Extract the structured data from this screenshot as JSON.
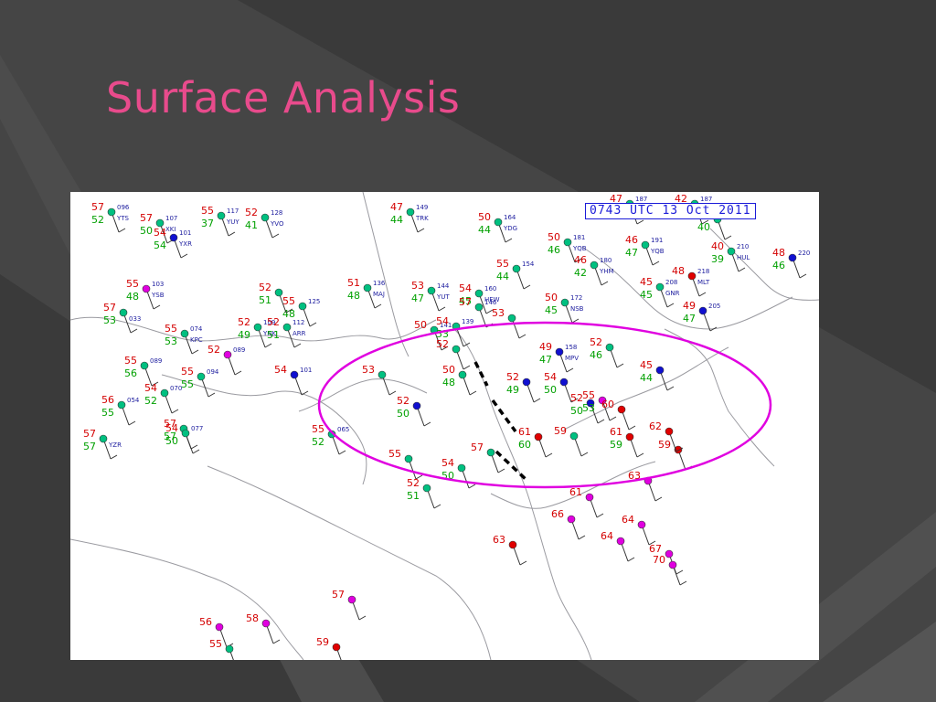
{
  "slide": {
    "title": "Surface Analysis",
    "title_color": "#e84b8c",
    "background_color": "#3a3a3a"
  },
  "map": {
    "timestamp": "0743 UTC 13 Oct 2011",
    "annotation_ellipse_color": "#e000e0",
    "front_color": "#000000",
    "temp_color": "#d40000",
    "dewpoint_color": "#00a000",
    "station_label_color": "#2020a0",
    "cover_colors": {
      "clear": "#00c080",
      "mostly": "#1010d0",
      "rain": "#e000e0",
      "overcast": "#e00000"
    },
    "stations": [
      {
        "t": "57",
        "d": "52",
        "code": "YTS",
        "p": "096",
        "cover": "clear"
      },
      {
        "t": "55",
        "d": "37",
        "code": "YUY",
        "p": "117",
        "cover": "clear"
      },
      {
        "t": "52",
        "d": "41",
        "code": "YVO",
        "p": "128",
        "cover": "clear"
      },
      {
        "t": "57",
        "d": "50",
        "code": "XKI",
        "p": "107",
        "cover": "clear"
      },
      {
        "t": "54",
        "d": "54",
        "code": "YXR",
        "p": "101",
        "cover": "mostly"
      },
      {
        "t": "47",
        "d": "44",
        "code": "TRK",
        "p": "149",
        "cover": "clear"
      },
      {
        "t": "50",
        "d": "44",
        "code": "YDG",
        "p": "164",
        "cover": "clear"
      },
      {
        "t": "50",
        "d": "46",
        "code": "YQB",
        "p": "181",
        "cover": "clear"
      },
      {
        "t": "47",
        "d": "46",
        "code": "YNH",
        "p": "187",
        "cover": "clear"
      },
      {
        "t": "42",
        "d": "40",
        "code": "",
        "p": "187",
        "cover": "clear"
      },
      {
        "t": "44",
        "d": "40",
        "code": "",
        "p": "204",
        "cover": "clear"
      },
      {
        "t": "46",
        "d": "47",
        "code": "YQB",
        "p": "191",
        "cover": "clear"
      },
      {
        "t": "46",
        "d": "42",
        "code": "YHM",
        "p": "180",
        "cover": "clear"
      },
      {
        "t": "40",
        "d": "39",
        "code": "HUL",
        "p": "210",
        "cover": "clear"
      },
      {
        "t": "48",
        "d": "46",
        "code": "",
        "p": "220",
        "cover": "mostly"
      },
      {
        "t": "55",
        "d": "44",
        "code": "",
        "p": "154",
        "cover": "clear"
      },
      {
        "t": "48",
        "d": "",
        "code": "MLT",
        "p": "218",
        "cover": "overcast"
      },
      {
        "t": "45",
        "d": "45",
        "code": "GNR",
        "p": "208",
        "cover": "clear"
      },
      {
        "t": "55",
        "d": "48",
        "code": "YSB",
        "p": "103",
        "cover": "rain"
      },
      {
        "t": "51",
        "d": "48",
        "code": "MAJ",
        "p": "136",
        "cover": "clear"
      },
      {
        "t": "53",
        "d": "47",
        "code": "YUT",
        "p": "144",
        "cover": "clear"
      },
      {
        "t": "54",
        "d": "45",
        "code": "HEW",
        "p": "160",
        "cover": "clear"
      },
      {
        "t": "50",
        "d": "45",
        "code": "NSB",
        "p": "172",
        "cover": "clear"
      },
      {
        "t": "49",
        "d": "47",
        "code": "",
        "p": "205",
        "cover": "mostly"
      },
      {
        "t": "55",
        "d": "48",
        "code": "",
        "p": "125",
        "cover": "clear"
      },
      {
        "t": "52",
        "d": "51",
        "code": "",
        "p": "",
        "cover": "clear"
      },
      {
        "t": "57",
        "d": "",
        "code": "",
        "p": "146",
        "cover": "clear"
      },
      {
        "t": "50",
        "d": "",
        "code": "",
        "p": "141",
        "cover": "clear"
      },
      {
        "t": "57",
        "d": "53",
        "code": "033",
        "p": "",
        "cover": "clear"
      },
      {
        "t": "55",
        "d": "53",
        "code": "KPC",
        "p": "074",
        "cover": "clear"
      },
      {
        "t": "52",
        "d": "49",
        "code": "YNK",
        "p": "109",
        "cover": "clear"
      },
      {
        "t": "52",
        "d": "51",
        "code": "ARR",
        "p": "112",
        "cover": "clear"
      },
      {
        "t": "54",
        "d": "53",
        "code": "",
        "p": "139",
        "cover": "clear"
      },
      {
        "t": "53",
        "d": "",
        "code": "",
        "p": "",
        "cover": "clear"
      },
      {
        "t": "52",
        "d": "",
        "code": "",
        "p": "089",
        "cover": "rain"
      },
      {
        "t": "55",
        "d": "56",
        "code": "",
        "p": "089",
        "cover": "clear"
      },
      {
        "t": "55",
        "d": "55",
        "code": "",
        "p": "094",
        "cover": "clear"
      },
      {
        "t": "54",
        "d": "",
        "code": "",
        "p": "101",
        "cover": "mostly"
      },
      {
        "t": "53",
        "d": "",
        "code": "",
        "p": "",
        "cover": "clear"
      },
      {
        "t": "52",
        "d": "50",
        "code": "",
        "p": "",
        "cover": "mostly"
      },
      {
        "t": "50",
        "d": "48",
        "code": "",
        "p": "",
        "cover": "clear"
      },
      {
        "t": "52",
        "d": "",
        "code": "",
        "p": "",
        "cover": "clear"
      },
      {
        "t": "56",
        "d": "55",
        "code": "",
        "p": "054",
        "cover": "clear"
      },
      {
        "t": "54",
        "d": "52",
        "code": "",
        "p": "070",
        "cover": "clear"
      },
      {
        "t": "57",
        "d": "57",
        "code": "",
        "p": "",
        "cover": "clear"
      },
      {
        "t": "57",
        "d": "57",
        "code": "YZR",
        "p": "",
        "cover": "clear"
      },
      {
        "t": "54",
        "d": "50",
        "code": "",
        "p": "077",
        "cover": "clear"
      },
      {
        "t": "55",
        "d": "52",
        "code": "",
        "p": "065",
        "cover": "clear"
      },
      {
        "t": "61",
        "d": "60",
        "code": "",
        "p": "",
        "cover": "overcast"
      },
      {
        "t": "59",
        "d": "",
        "code": "",
        "p": "",
        "cover": "clear"
      },
      {
        "t": "57",
        "d": "",
        "code": "",
        "p": "",
        "cover": "clear"
      },
      {
        "t": "55",
        "d": "",
        "code": "",
        "p": "",
        "cover": "clear"
      },
      {
        "t": "54",
        "d": "50",
        "code": "",
        "p": "",
        "cover": "clear"
      },
      {
        "t": "52",
        "d": "51",
        "code": "",
        "p": "",
        "cover": "clear"
      },
      {
        "t": "49",
        "d": "47",
        "code": "MPV",
        "p": "158",
        "cover": "mostly"
      },
      {
        "t": "52",
        "d": "46",
        "code": "",
        "p": "",
        "cover": "clear"
      },
      {
        "t": "52",
        "d": "49",
        "code": "",
        "p": "",
        "cover": "mostly"
      },
      {
        "t": "54",
        "d": "50",
        "code": "",
        "p": "",
        "cover": "mostly"
      },
      {
        "t": "45",
        "d": "44",
        "code": "",
        "p": "",
        "cover": "mostly"
      },
      {
        "t": "52",
        "d": "50",
        "code": "",
        "p": "",
        "cover": "mostly"
      },
      {
        "t": "55",
        "d": "53",
        "code": "",
        "p": "",
        "cover": "rain"
      },
      {
        "t": "60",
        "d": "",
        "code": "",
        "p": "",
        "cover": "overcast"
      },
      {
        "t": "59",
        "d": "",
        "code": "",
        "p": "",
        "cover": "overcast"
      },
      {
        "t": "61",
        "d": "59",
        "code": "",
        "p": "",
        "cover": "overcast"
      },
      {
        "t": "62",
        "d": "",
        "code": "",
        "p": "",
        "cover": "overcast"
      },
      {
        "t": "63",
        "d": "",
        "code": "",
        "p": "",
        "cover": "rain"
      },
      {
        "t": "61",
        "d": "",
        "code": "",
        "p": "",
        "cover": "rain"
      },
      {
        "t": "66",
        "d": "",
        "code": "",
        "p": "",
        "cover": "rain"
      },
      {
        "t": "64",
        "d": "",
        "code": "",
        "p": "",
        "cover": "rain"
      },
      {
        "t": "67",
        "d": "",
        "code": "",
        "p": "",
        "cover": "rain"
      },
      {
        "t": "70",
        "d": "",
        "code": "",
        "p": "",
        "cover": "rain"
      },
      {
        "t": "64",
        "d": "",
        "code": "",
        "p": "",
        "cover": "rain"
      },
      {
        "t": "57",
        "d": "",
        "code": "",
        "p": "",
        "cover": "rain"
      },
      {
        "t": "58",
        "d": "",
        "code": "",
        "p": "",
        "cover": "rain"
      },
      {
        "t": "59",
        "d": "",
        "code": "",
        "p": "",
        "cover": "overcast"
      },
      {
        "t": "56",
        "d": "",
        "code": "",
        "p": "",
        "cover": "rain"
      },
      {
        "t": "55",
        "d": "",
        "code": "",
        "p": "",
        "cover": "clear"
      },
      {
        "t": "63",
        "d": "",
        "code": "",
        "p": "",
        "cover": "overcast"
      }
    ]
  }
}
